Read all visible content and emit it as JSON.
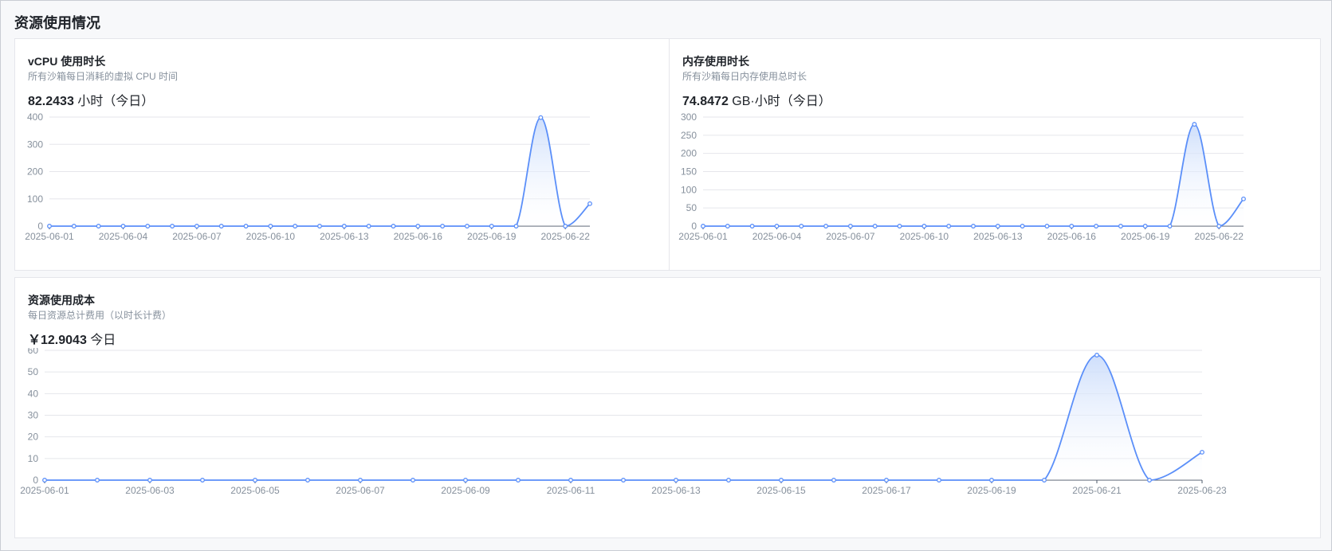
{
  "section": {
    "title": "资源使用情况"
  },
  "cards": {
    "vcpu": {
      "title": "vCPU 使用时长",
      "subtitle": "所有沙箱每日消耗的虚拟 CPU 时间",
      "value": "82.2433",
      "unit": "小时（今日）"
    },
    "memory": {
      "title": "内存使用时长",
      "subtitle": "所有沙箱每日内存使用总时长",
      "value": "74.8472",
      "unit": "GB·小时（今日）"
    },
    "cost": {
      "title": "资源使用成本",
      "subtitle": "每日资源总计费用（以时长计费）",
      "value": "￥12.9043",
      "unit": "今日"
    }
  },
  "colors": {
    "line": "#5b8ff9",
    "fill_top": "#c9dbfb",
    "fill_bottom": "#ffffff",
    "grid": "#e5e6eb"
  },
  "chart_data": [
    {
      "type": "area",
      "title": "vCPU 使用时长",
      "x": [
        "2025-06-01",
        "2025-06-02",
        "2025-06-03",
        "2025-06-04",
        "2025-06-05",
        "2025-06-06",
        "2025-06-07",
        "2025-06-08",
        "2025-06-09",
        "2025-06-10",
        "2025-06-11",
        "2025-06-12",
        "2025-06-13",
        "2025-06-14",
        "2025-06-15",
        "2025-06-16",
        "2025-06-17",
        "2025-06-18",
        "2025-06-19",
        "2025-06-20",
        "2025-06-21",
        "2025-06-22",
        "2025-06-23"
      ],
      "values": [
        0,
        0,
        0,
        0,
        0,
        0,
        0,
        0,
        0,
        0,
        0,
        0,
        0,
        0,
        0,
        0,
        0,
        0,
        0,
        0,
        398,
        0,
        82.2433
      ],
      "xticks": [
        "2025-06-01",
        "2025-06-04",
        "2025-06-07",
        "2025-06-10",
        "2025-06-13",
        "2025-06-16",
        "2025-06-19",
        "2025-06-22"
      ],
      "yticks": [
        0,
        100,
        200,
        300,
        400
      ],
      "ylim": [
        0,
        400
      ],
      "grid": true
    },
    {
      "type": "area",
      "title": "内存使用时长",
      "x": [
        "2025-06-01",
        "2025-06-02",
        "2025-06-03",
        "2025-06-04",
        "2025-06-05",
        "2025-06-06",
        "2025-06-07",
        "2025-06-08",
        "2025-06-09",
        "2025-06-10",
        "2025-06-11",
        "2025-06-12",
        "2025-06-13",
        "2025-06-14",
        "2025-06-15",
        "2025-06-16",
        "2025-06-17",
        "2025-06-18",
        "2025-06-19",
        "2025-06-20",
        "2025-06-21",
        "2025-06-22",
        "2025-06-23"
      ],
      "values": [
        0,
        0,
        0,
        0,
        0,
        0,
        0,
        0,
        0,
        0,
        0,
        0,
        0,
        0,
        0,
        0,
        0,
        0,
        0,
        0,
        280,
        0,
        74.8472
      ],
      "xticks": [
        "2025-06-01",
        "2025-06-04",
        "2025-06-07",
        "2025-06-10",
        "2025-06-13",
        "2025-06-16",
        "2025-06-19",
        "2025-06-22"
      ],
      "yticks": [
        0,
        50,
        100,
        150,
        200,
        250,
        300
      ],
      "ylim": [
        0,
        300
      ],
      "grid": true
    },
    {
      "type": "area",
      "title": "资源使用成本",
      "x": [
        "2025-06-01",
        "2025-06-02",
        "2025-06-03",
        "2025-06-04",
        "2025-06-05",
        "2025-06-06",
        "2025-06-07",
        "2025-06-08",
        "2025-06-09",
        "2025-06-10",
        "2025-06-11",
        "2025-06-12",
        "2025-06-13",
        "2025-06-14",
        "2025-06-15",
        "2025-06-16",
        "2025-06-17",
        "2025-06-18",
        "2025-06-19",
        "2025-06-20",
        "2025-06-21",
        "2025-06-22",
        "2025-06-23"
      ],
      "values": [
        0,
        0,
        0,
        0,
        0,
        0,
        0,
        0,
        0,
        0,
        0,
        0,
        0,
        0,
        0,
        0,
        0,
        0,
        0,
        0,
        57.8,
        0,
        12.9043
      ],
      "xticks": [
        "2025-06-01",
        "2025-06-03",
        "2025-06-05",
        "2025-06-07",
        "2025-06-09",
        "2025-06-11",
        "2025-06-13",
        "2025-06-15",
        "2025-06-17",
        "2025-06-19",
        "2025-06-21",
        "2025-06-23"
      ],
      "yticks": [
        0,
        10,
        20,
        30,
        40,
        50,
        60
      ],
      "ylim": [
        0,
        60
      ],
      "grid": true
    }
  ]
}
